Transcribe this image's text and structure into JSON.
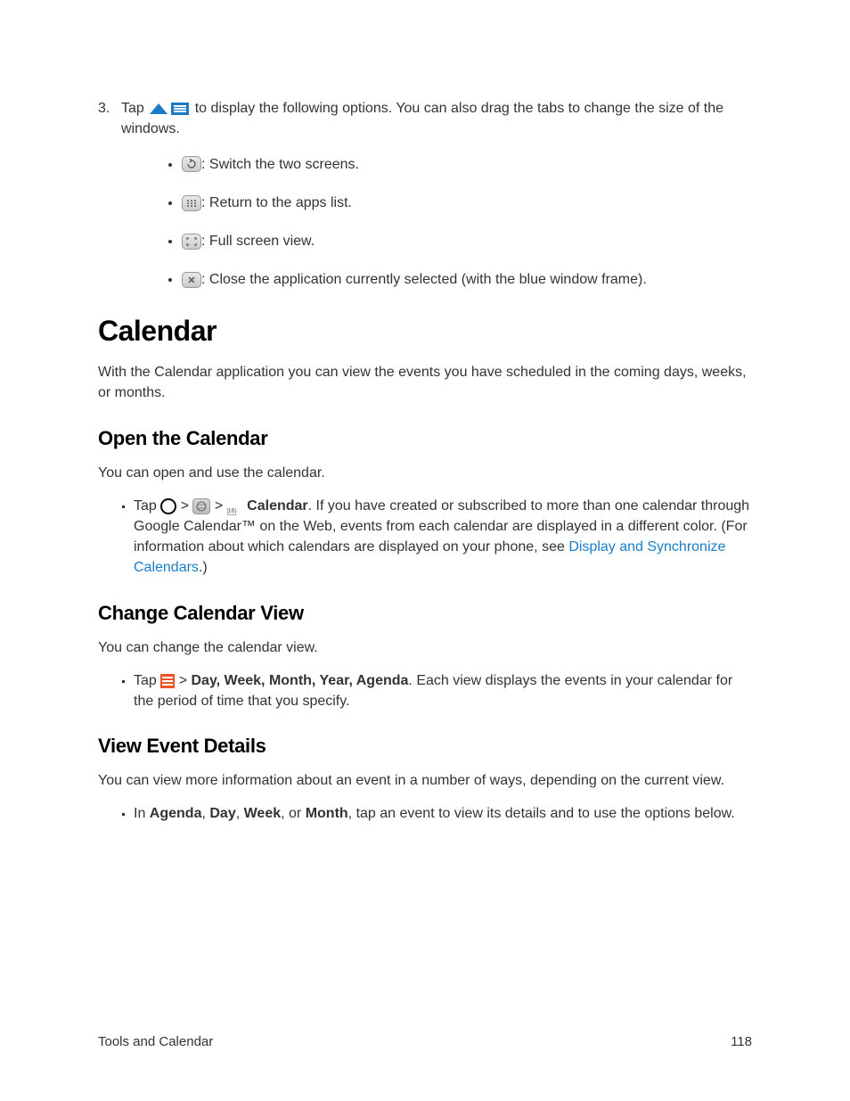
{
  "step3": {
    "number": "3.",
    "pre": "Tap ",
    "post": " to display the following options. You can also drag the tabs to change the size of the windows.",
    "bullets": {
      "switch": ": Switch the two screens.",
      "return": ": Return to the apps list.",
      "full": ": Full screen view.",
      "close": ": Close the application currently selected (with the blue window frame)."
    }
  },
  "calendar": {
    "heading": "Calendar",
    "intro": "With the Calendar application you can view the events you have scheduled in the coming days, weeks, or months."
  },
  "open": {
    "heading": "Open the Calendar",
    "intro": "You can open and use the calendar.",
    "bullet": {
      "pre": "Tap ",
      "gt1": " > ",
      "gt2": " >  ",
      "cal_label": "Calendar",
      "post1": ". If you have created or subscribed to more than one calendar through Google Calendar™ on the Web, events from each calendar are displayed in a different color. (For information about which calendars are displayed on your phone, see ",
      "link": "Display and Synchronize Calendars",
      "post2": ".)"
    }
  },
  "change": {
    "heading": "Change Calendar View",
    "intro": "You can change the calendar view.",
    "bullet": {
      "pre": "Tap ",
      "gt": " > ",
      "views": "Day, Week, Month, Year, Agenda",
      "post": ". Each view displays the events in your calendar for the period of time that you specify."
    }
  },
  "details": {
    "heading": "View Event Details",
    "intro": "You can view more information about an event in a number of ways, depending on the current view.",
    "bullet": {
      "pre": "In ",
      "v1": "Agenda",
      "c1": ", ",
      "v2": "Day",
      "c2": ", ",
      "v3": "Week",
      "c3": ", or ",
      "v4": "Month",
      "post": ", tap an event to view its details and to use the options below."
    }
  },
  "footer": {
    "section": "Tools and Calendar",
    "page": "118"
  }
}
